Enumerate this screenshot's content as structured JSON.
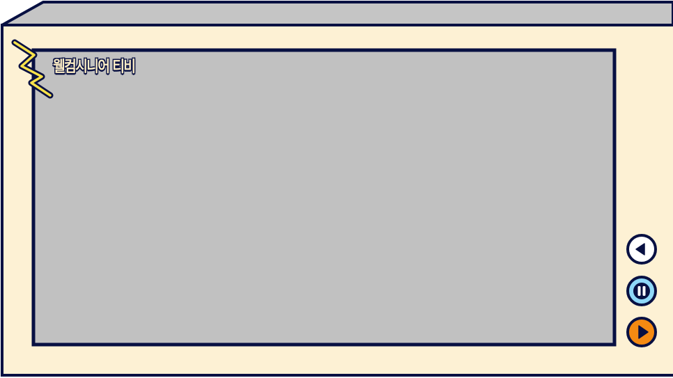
{
  "player": {
    "channel_title": "웰컴시니어 티비"
  },
  "controls": {
    "previous": {
      "icon": "triangle-left-icon",
      "fill": "#ffffff"
    },
    "pause": {
      "icon": "pause-icon",
      "fill": "#8fd8f8"
    },
    "play": {
      "icon": "triangle-right-icon",
      "fill": "#f58a12"
    }
  },
  "theme": {
    "outline": "#081042",
    "bezel": "#fdf1d4",
    "top_face": "#c5c5c5",
    "screen": "#c1c1c1",
    "bolt": "#f8e24a"
  }
}
